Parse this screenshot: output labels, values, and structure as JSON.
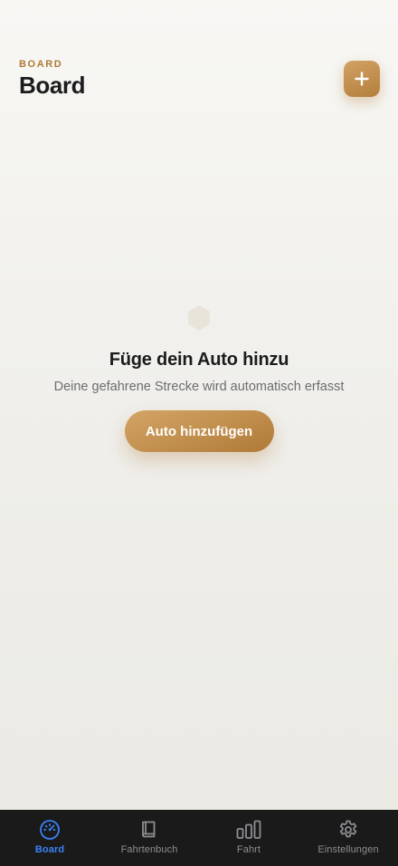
{
  "header": {
    "eyebrow": "BOARD",
    "title": "Board",
    "add_button_icon": "plus-icon"
  },
  "empty_state": {
    "icon": "hexagon-icon",
    "title": "Füge dein Auto hinzu",
    "subtitle": "Deine gefahrene Strecke wird automatisch erfasst",
    "cta_label": "Auto hinzufügen"
  },
  "tabbar": {
    "items": [
      {
        "label": "Board",
        "icon": "speedometer-icon",
        "active": true
      },
      {
        "label": "Fahrtenbuch",
        "icon": "book-icon",
        "active": false
      },
      {
        "label": "Fahrt",
        "icon": "bar-chart-icon",
        "active": false
      },
      {
        "label": "Einstellungen",
        "icon": "gear-icon",
        "active": false
      }
    ]
  },
  "colors": {
    "accent": "#b07a37",
    "active_tab": "#3b82f6",
    "inactive_tab": "#8e8e93",
    "tabbar_bg": "#1a1a1a"
  }
}
